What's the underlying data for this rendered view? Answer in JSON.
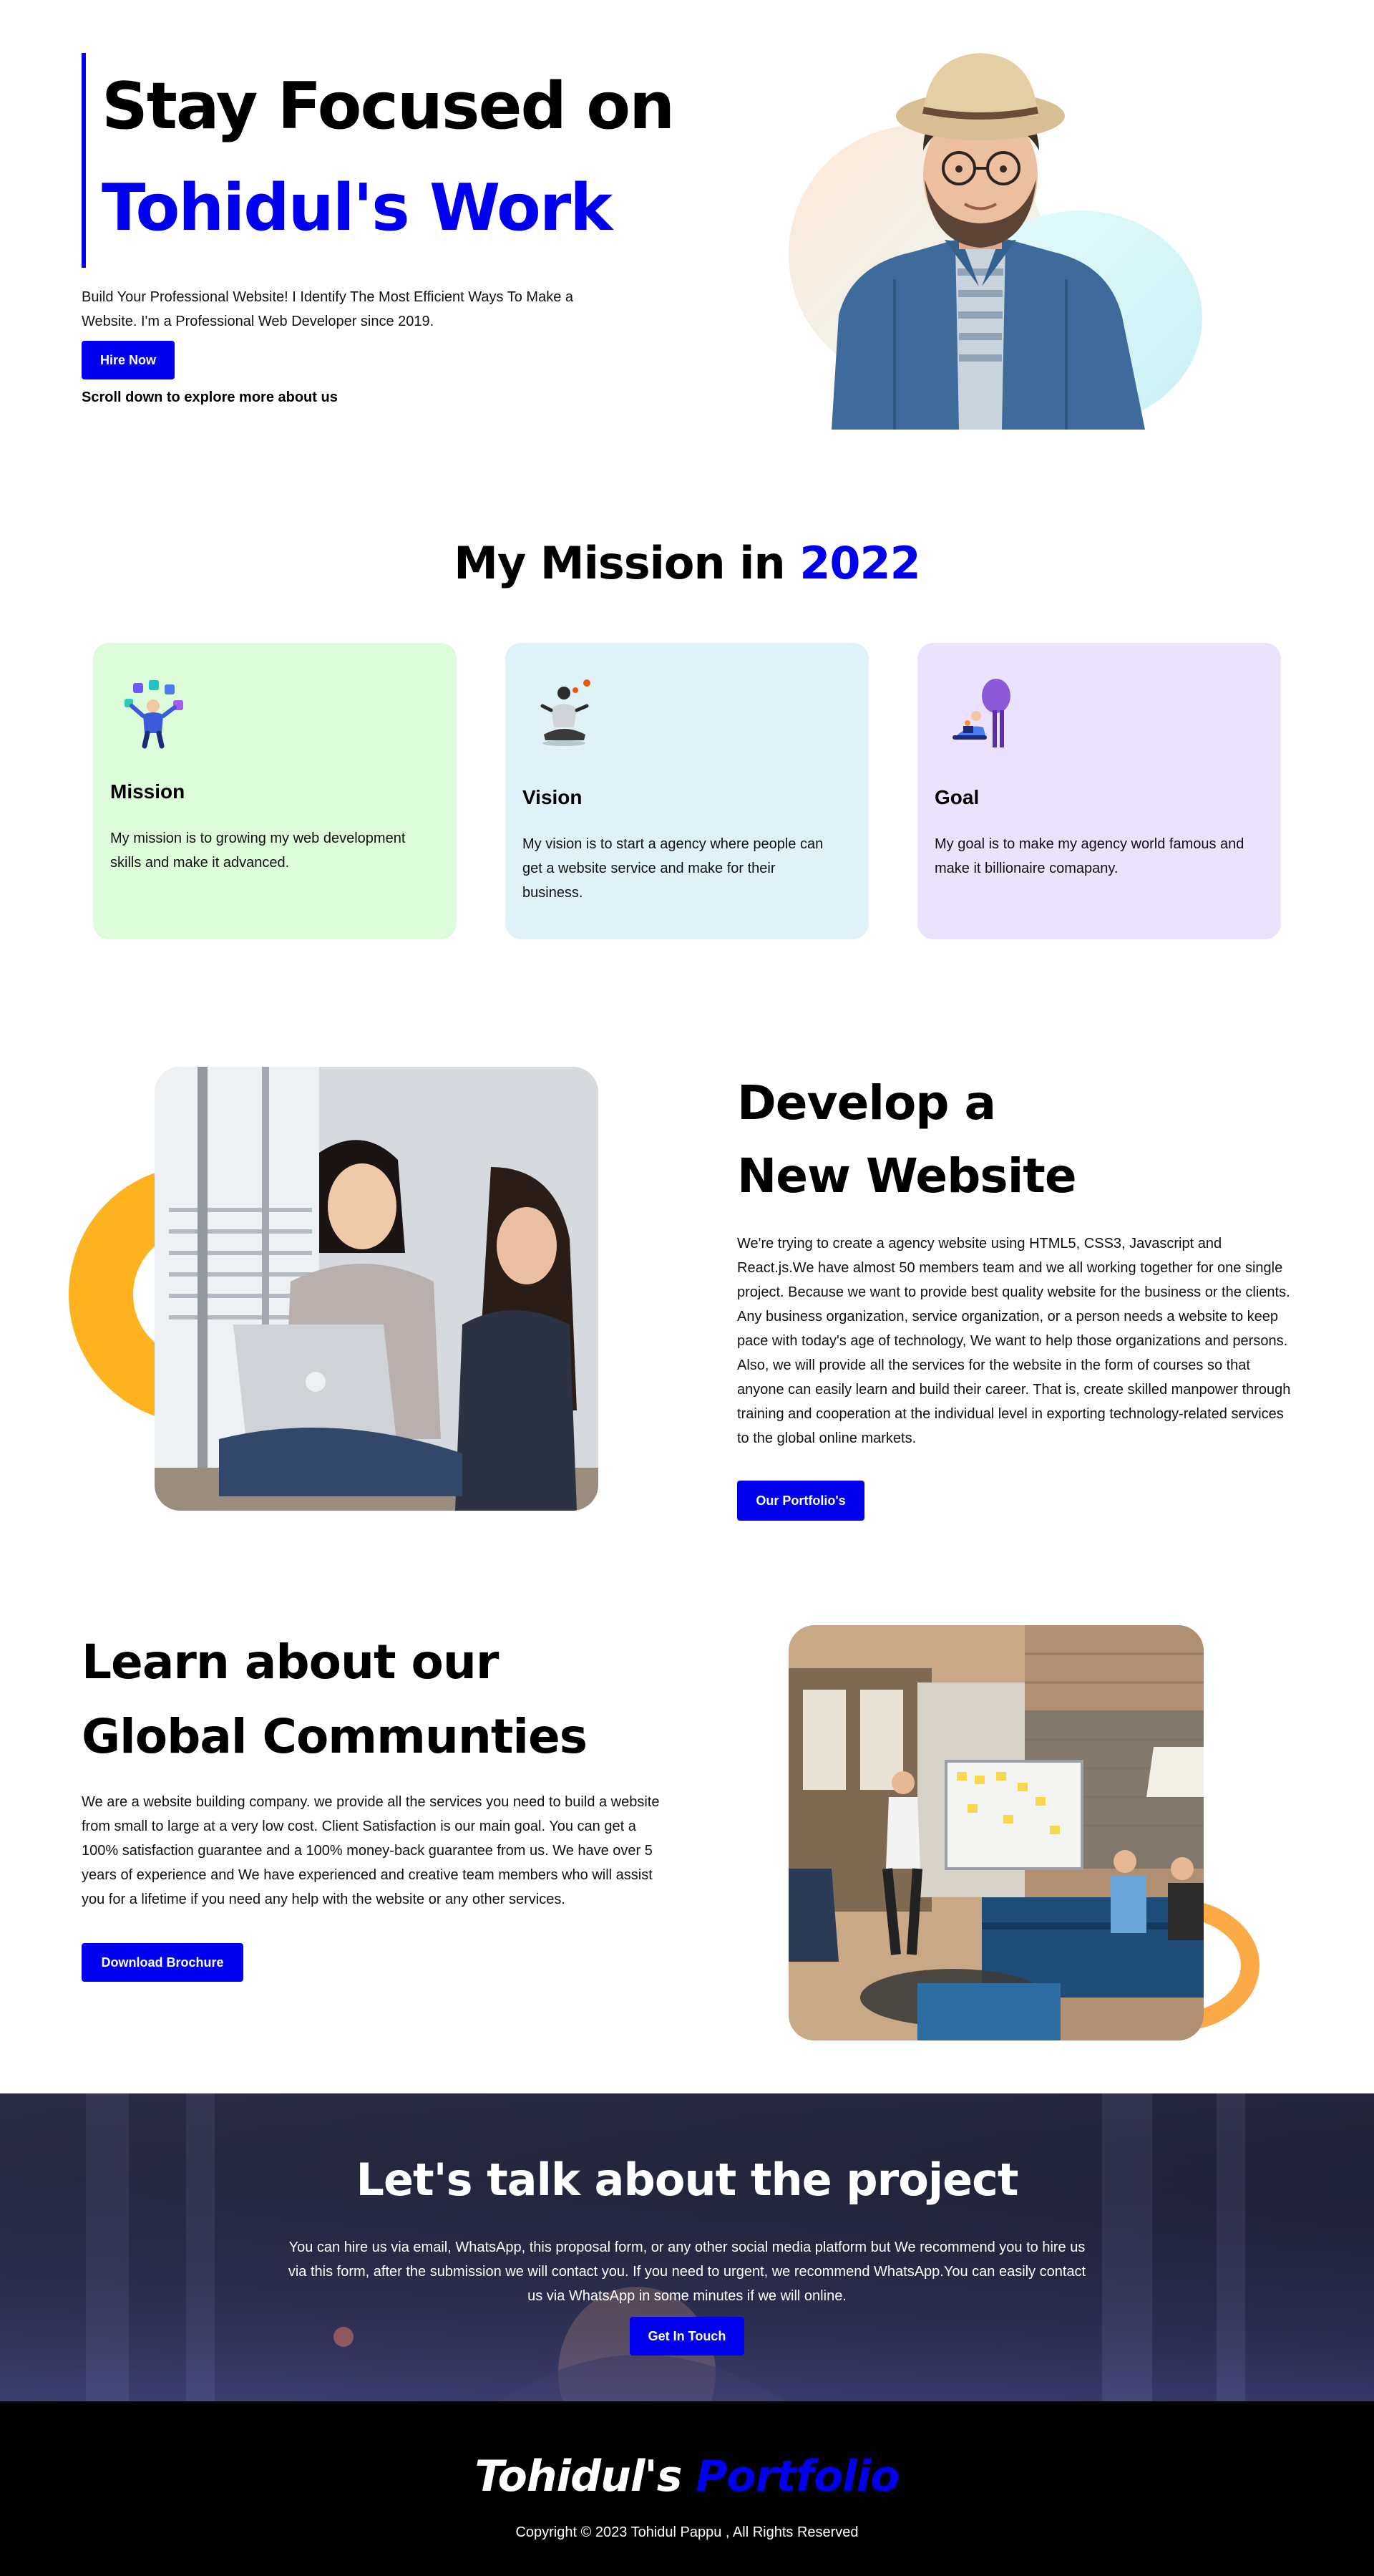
{
  "hero": {
    "title_line1": "Stay Focused on",
    "title_line2": "Tohidul's Work",
    "description": "Build Your Professional Website! I Identify The Most Efficient Ways To Make a Website. I'm a Professional Web Developer since 2019.",
    "hire_button": "Hire Now",
    "scroll_hint": "Scroll down to explore more about us"
  },
  "mission": {
    "title_prefix": "My Mission in",
    "title_year": "2022",
    "cards": [
      {
        "title": "Mission",
        "text": "My mission is to growing my web development skills and make it advanced.",
        "icon": "juggler-icon"
      },
      {
        "title": "Vision",
        "text": "My vision is to start a agency where people can get a website service and make for their business.",
        "icon": "meditation-icon"
      },
      {
        "title": "Goal",
        "text": "My goal is to make my agency world famous and make it billionaire comapany.",
        "icon": "goal-person-icon"
      }
    ]
  },
  "develop": {
    "title_line1": "Develop a",
    "title_line2": "New Website",
    "text": "We're trying to create a agency website using HTML5, CSS3, Javascript and React.js.We have almost 50 members team and we all working together for one single project. Because we want to provide best quality website for the business or the clients. Any business organization, service organization, or a person needs a website to keep pace with today's age of technology, We want to help those organizations and persons. Also, we will provide all the services for the website in the form of courses so that anyone can easily learn and build their career. That is, create skilled manpower through training and cooperation at the individual level in exporting technology-related services to the global online markets.",
    "button": "Our Portfolio's"
  },
  "learn": {
    "title_line1": "Learn about our",
    "title_line2": "Global Communties",
    "text": "We are a website building company. we provide all the services you need to build a website from small to large at a very low cost. Client Satisfaction is our main goal. You can get a 100% satisfaction guarantee and a 100% money-back guarantee from us. We have over 5 years of experience and We have experienced and creative team members who will assist you for a lifetime if you need any help with the website or any other services.",
    "button": "Download Brochure"
  },
  "contact": {
    "title": "Let's talk about the project",
    "text": "You can hire us via email, WhatsApp, this proposal form, or any other social media platform but We recommend you to hire us via this form, after the submission we will contact you. If you need to urgent, we recommend WhatsApp.You can easily contact us via WhatsApp in some minutes if we will online.",
    "button": "Get In Touch"
  },
  "footer": {
    "brand_name": "Tohidul's",
    "brand_accent": "Portfolio",
    "copyright": "Copyright © 2023 Tohidul Pappu , All Rights Reserved"
  },
  "colors": {
    "accent": "#0000ee",
    "mission_card": "#ddfcd9",
    "vision_card": "#e0f1f8",
    "goal_card": "#ebe2fe",
    "orange_ring": "#fdb21f",
    "footer_bg": "#000000"
  }
}
